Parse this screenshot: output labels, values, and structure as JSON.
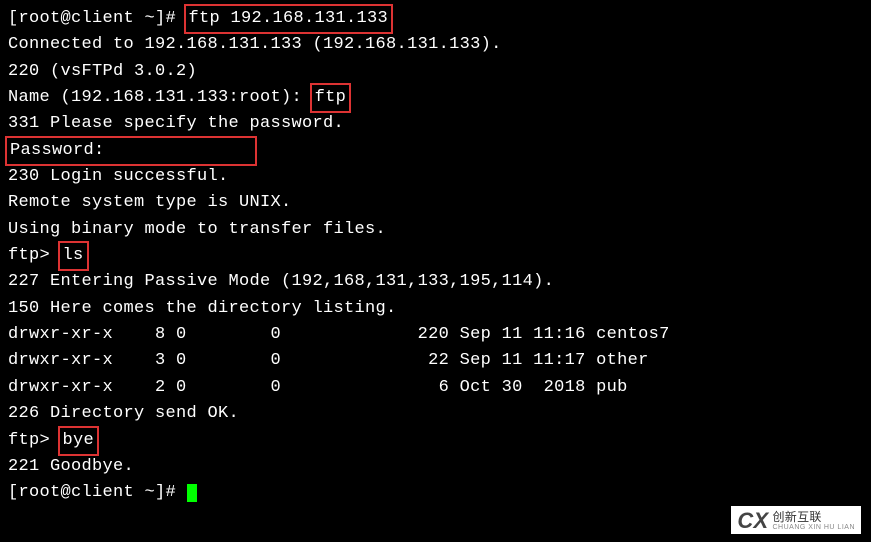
{
  "prompt1_prefix": "[root@client ~]# ",
  "cmd_ftp": "ftp 192.168.131.133",
  "connected": "Connected to 192.168.131.133 (192.168.131.133).",
  "banner": "220 (vsFTPd 3.0.2)",
  "name_prefix": "Name (192.168.131.133:root): ",
  "name_input": "ftp",
  "resp331": "331 Please specify the password.",
  "password_label": "Password:",
  "resp230": "230 Login successful.",
  "sys_type": "Remote system type is UNIX.",
  "binary_mode": "Using binary mode to transfer files.",
  "ftp_prompt": "ftp> ",
  "cmd_ls": "ls",
  "resp227": "227 Entering Passive Mode (192,168,131,133,195,114).",
  "resp150": "150 Here comes the directory listing.",
  "listing": [
    "drwxr-xr-x    8 0        0             220 Sep 11 11:16 centos7",
    "drwxr-xr-x    3 0        0              22 Sep 11 11:17 other",
    "drwxr-xr-x    2 0        0               6 Oct 30  2018 pub"
  ],
  "resp226": "226 Directory send OK.",
  "cmd_bye": "bye",
  "resp221": "221 Goodbye.",
  "prompt2_prefix": "[root@client ~]# ",
  "watermark_cn": "创新互联",
  "watermark_py": "CHUANG XIN HU LIAN"
}
